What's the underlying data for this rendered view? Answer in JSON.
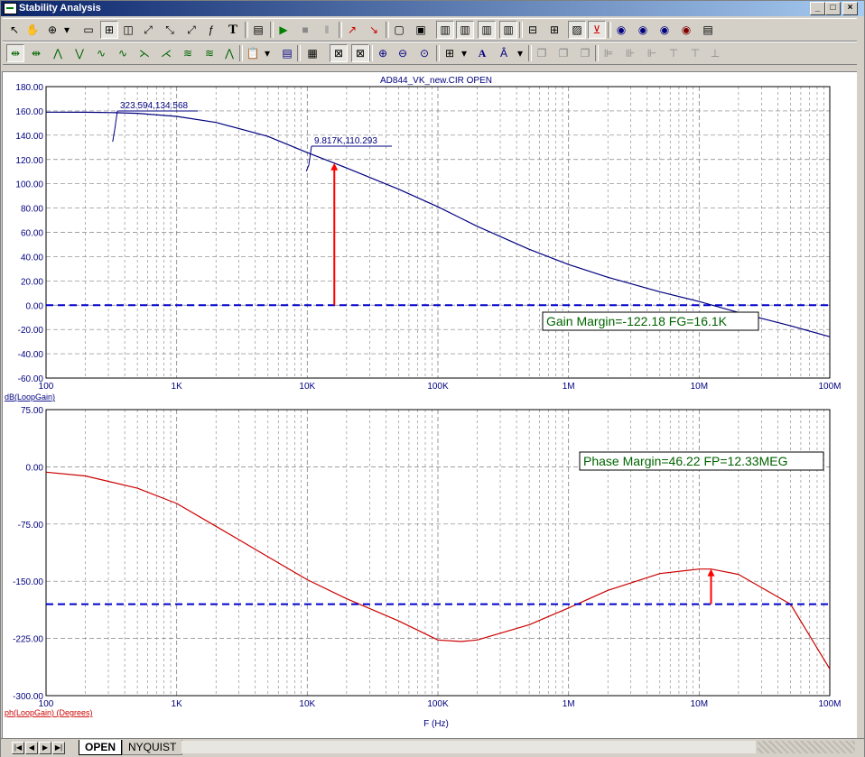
{
  "window": {
    "title": "Stability Analysis",
    "controls": [
      "_",
      "□",
      "×"
    ]
  },
  "plot_title": "AD844_VK_new.CIR OPEN",
  "tabs": {
    "open": "OPEN",
    "nyquist": "NYQUIST"
  },
  "colors": {
    "gain": "#000080",
    "phase": "#cc0000",
    "marker": "#ff0000",
    "reference": "#0000cc",
    "annotation": "#006400",
    "grid": "#808080"
  },
  "chart_data": [
    {
      "type": "line",
      "xscale": "log",
      "xlim": [
        100,
        100000000
      ],
      "x_ticks": [
        "100",
        "1K",
        "10K",
        "100K",
        "1M",
        "10M",
        "100M"
      ],
      "ylim": [
        -60,
        180
      ],
      "y_ticks": [
        "180.00",
        "160.00",
        "140.00",
        "120.00",
        "100.00",
        "80.00",
        "60.00",
        "40.00",
        "20.00",
        "0.00",
        "-20.00",
        "-40.00",
        "-60.00"
      ],
      "ylabel": "dB(LoopGain)",
      "grid": true,
      "series": [
        {
          "name": "dB(LoopGain)",
          "x": [
            100,
            200,
            323.594,
            500,
            1000,
            2000,
            5000,
            9817,
            16100,
            20000,
            50000,
            100000,
            200000,
            500000,
            1000000,
            2000000,
            5000000,
            10000000,
            20000000,
            50000000,
            100000000
          ],
          "y": [
            159,
            158.9,
            158.6,
            158,
            155.5,
            150.5,
            139,
            126,
            117,
            113,
            95.5,
            81,
            65,
            46,
            33.5,
            23,
            11,
            3,
            -6,
            -17,
            -26
          ]
        },
        {
          "name": "reference",
          "style": "dashed",
          "x": [
            100,
            100000000
          ],
          "y": [
            0,
            0
          ]
        }
      ],
      "markers": [
        {
          "x": 16100,
          "y_from": 0,
          "y_to": 117,
          "type": "arrow"
        }
      ],
      "annotations": [
        {
          "text": "323.594,134.568",
          "x": 323.594,
          "y": 134.568
        },
        {
          "text": "9.817K,110.293",
          "x": 9817,
          "y": 110.293
        },
        {
          "text": "Gain Margin=-122.18 FG=16.1K",
          "boxed": true
        }
      ]
    },
    {
      "type": "line",
      "xscale": "log",
      "xlim": [
        100,
        100000000
      ],
      "x_ticks": [
        "100",
        "1K",
        "10K",
        "100K",
        "1M",
        "10M",
        "100M"
      ],
      "ylim": [
        -300,
        75
      ],
      "y_ticks": [
        "75.00",
        "0.00",
        "-75.00",
        "-150.00",
        "-225.00",
        "-300.00"
      ],
      "ylabel": "ph(LoopGain) (Degrees)",
      "xlabel": "F (Hz)",
      "grid": true,
      "series": [
        {
          "name": "ph(LoopGain) (Degrees)",
          "x": [
            100,
            200,
            500,
            1000,
            2000,
            5000,
            10000,
            20000,
            50000,
            100000,
            150000,
            200000,
            500000,
            1000000,
            2000000,
            5000000,
            10000000,
            12330000,
            20000000,
            50000000,
            100000000
          ],
          "y": [
            -7,
            -12,
            -28,
            -48,
            -78,
            -118,
            -148,
            -173,
            -202,
            -227,
            -229,
            -227,
            -207,
            -185,
            -162,
            -140,
            -134,
            -134,
            -141,
            -180,
            -265
          ]
        },
        {
          "name": "reference",
          "style": "dashed",
          "x": [
            100,
            100000000
          ],
          "y": [
            -180,
            -180
          ]
        }
      ],
      "markers": [
        {
          "x": 12330000,
          "y_from": -180,
          "y_to": -134,
          "type": "arrow"
        }
      ],
      "annotations": [
        {
          "text": "Phase Margin=46.22 FP=12.33MEG",
          "boxed": true
        }
      ]
    }
  ]
}
